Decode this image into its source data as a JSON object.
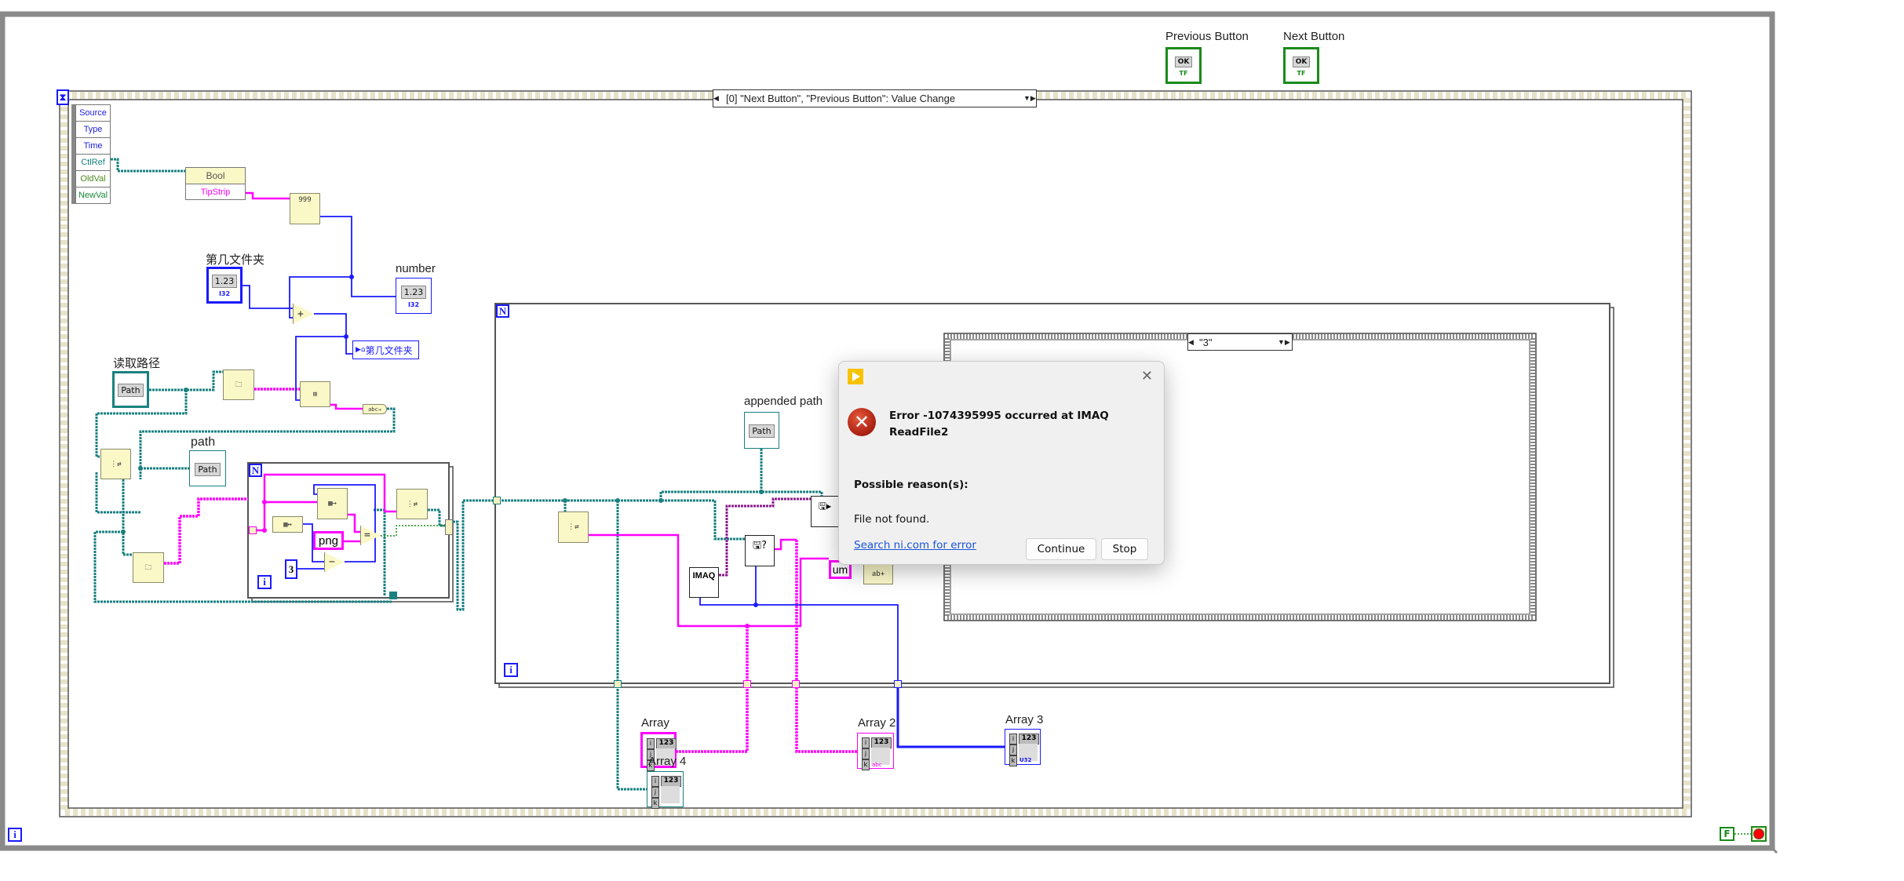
{
  "front_controls": {
    "previous_button": {
      "label": "Previous Button",
      "glyph": "OK",
      "type_tag": "TF"
    },
    "next_button": {
      "label": "Next Button",
      "glyph": "OK",
      "type_tag": "TF"
    }
  },
  "event_structure": {
    "selector": "[0] \"Next Button\", \"Previous Button\": Value Change",
    "event_data_fields": [
      "Source",
      "Type",
      "Time",
      "CtlRef",
      "OldVal",
      "NewVal"
    ]
  },
  "property_node": {
    "class": "Bool",
    "property": "TipStrip"
  },
  "number_to_string_node": {
    "glyph": "999"
  },
  "folder_index_control": {
    "label": "第几文件夹",
    "value_glyph": "1.23",
    "type_tag": "I32"
  },
  "number_indicator": {
    "label": "number",
    "value_glyph": "1.23",
    "type_tag": "I32"
  },
  "folder_index_local": {
    "label": "第几文件夹"
  },
  "read_path_control": {
    "label": "读取路径",
    "value_glyph": "Path"
  },
  "path_indicator": {
    "label": "path",
    "value_glyph": "Path"
  },
  "inner_loop": {
    "count_terminal": "N",
    "iteration_terminal": "i",
    "extension_constant": "png",
    "offset_constant": "3",
    "equal_glyph": "=",
    "subtract_glyph": "−",
    "add_glyph": "+"
  },
  "outer_loop": {
    "count_terminal": "N",
    "iteration_terminal": "i"
  },
  "appended_path_indicator": {
    "label": "appended path",
    "value_glyph": "Path"
  },
  "imaq_node": {
    "glyph": "IMAQ"
  },
  "case_structure": {
    "selector": "\"3\""
  },
  "string_constant": {
    "text": "um"
  },
  "arrays": [
    {
      "label": "Array",
      "glyph": "123",
      "type_tag": "abc"
    },
    {
      "label": "Array 4",
      "glyph": "123",
      "type_tag": "path"
    },
    {
      "label": "Array 2",
      "glyph": "123",
      "type_tag": "abc"
    },
    {
      "label": "Array 3",
      "glyph": "123",
      "type_tag": "U32"
    }
  ],
  "while_loop": {
    "iteration_terminal": "i",
    "stop_constant": "F"
  },
  "error_dialog": {
    "message": "Error -1074395995 occurred at IMAQ ReadFile2",
    "reason_heading": "Possible reason(s):",
    "reason": "File not found.",
    "link": "Search ni.com for error",
    "continue_label": "Continue",
    "stop_label": "Stop",
    "close_glyph": "✕"
  },
  "colors": {
    "path_wire": "#1a8080",
    "string_wire": "#ff00ff",
    "integer_wire": "#1a1aff",
    "image_wire": "#8a1a8a",
    "boolean": "#1a8a1a",
    "node_fill": "#fbf8c8",
    "dialog_bg": "#f0f0f0",
    "link": "#1a55d8"
  }
}
